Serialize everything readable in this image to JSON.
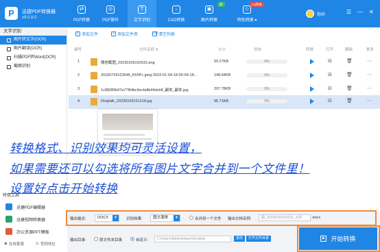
{
  "app": {
    "name": "迅捷PDF转换器",
    "version": "v9.0.8.0",
    "logo_letter": "P"
  },
  "nav": [
    {
      "label": "PDF转换",
      "icon": "convert-icon",
      "glyph": "⇄"
    },
    {
      "label": "PDF操作",
      "icon": "pdf-ops-icon",
      "glyph": "◎"
    },
    {
      "label": "文字识别",
      "icon": "ocr-icon",
      "glyph": "T"
    },
    {
      "label": "CAD转换",
      "icon": "cad-icon",
      "glyph": "↓"
    },
    {
      "label": "图片转换",
      "icon": "image-convert-icon",
      "glyph": "▣"
    },
    {
      "label": "特色转换",
      "icon": "special-convert-icon",
      "glyph": "◇"
    }
  ],
  "nav_badges": {
    "new": "新",
    "caj": "caj转换"
  },
  "nav_dropdown": "▾",
  "user": {
    "greeting": "你好"
  },
  "window_controls": [
    "☰",
    "—",
    "✕"
  ],
  "sidebar": {
    "title": "文字识别",
    "items": [
      {
        "label": "图片转文字(OCR)",
        "icon": "image-text-icon"
      },
      {
        "label": "图片翻译(OCR)",
        "icon": "image-translate-icon"
      },
      {
        "label": "扫描PDF转Word(OCR)",
        "icon": "scan-pdf-icon"
      },
      {
        "label": "截图识别",
        "icon": "screenshot-icon"
      }
    ]
  },
  "toolbar": {
    "add_file": "添加文件",
    "add_folder": "添加文件夹",
    "clear": "清空列表",
    "add_glyph": "+",
    "clear_glyph": "⌫"
  },
  "table": {
    "headers": {
      "index": "编号",
      "name": "文件名称 ⇅",
      "size": "大小",
      "status": "状态",
      "convert": "转换",
      "open": "打开",
      "delete": "删除",
      "more": "更多"
    },
    "rows": [
      {
        "index": "1",
        "name": "微信截图_20230106162632.png",
        "size": "50.27KB",
        "progress": "0%"
      },
      {
        "index": "2",
        "name": "20160724123546_Kh5Pc.jpeg-2023-01-04-18-00-54-18...",
        "size": "148.64KB",
        "progress": "0%"
      },
      {
        "index": "3",
        "name": "1c88280b97a77f64bc9ecfa8b44dcb8_副本_副本.jpg",
        "size": "207.78KB",
        "progress": "0%"
      },
      {
        "index": "4",
        "name": "Dingtalk_20230109151218.jpg",
        "size": "96.71KB",
        "progress": "0%"
      }
    ],
    "action_glyphs": {
      "open": "⊟",
      "delete": "🗑",
      "more": "⋯"
    }
  },
  "overlay": [
    "转换格式、识别效果均可灵活设置，",
    "如果需要还可以勾选将所有图片文字合并到一个文件里！",
    "设置好点击开始转换"
  ],
  "tools": {
    "title": "特色工具",
    "items": [
      {
        "label": "迅捷PDF编辑器",
        "color": "#1f86e5",
        "icon": "pdf-editor-icon"
      },
      {
        "label": "迅捷视频转换器",
        "color": "#2aa36b",
        "icon": "video-converter-icon"
      },
      {
        "label": "办公资源PPT模板",
        "color": "#e25b3a",
        "icon": "ppt-template-icon"
      }
    ]
  },
  "footer": {
    "online_service": "在线客服",
    "website": "官网地址"
  },
  "settings": {
    "format_label": "输出格式:",
    "format_value": "DOCX",
    "effect_label": "识别效果:",
    "effect_value": "图文混排",
    "merge_label": "合并到一个文件",
    "filename_label": "输出文档名称:",
    "filename_value": "图_20230106162632_合并",
    "filename_ext": ".docx",
    "dir_label": "输出目录:",
    "dir_option1": "原文件夹目录",
    "dir_option2": "自定义:",
    "dir_path": "C:\\Users\\Administrator\\Desktop",
    "change_btn": "更改",
    "open_folder_btn": "打开文件目录"
  },
  "start_button": {
    "label": "开始转换",
    "glyph": "▶"
  },
  "colors": {
    "primary": "#1f86e5",
    "highlight": "#f08a3c",
    "overlay_text": "#1a4fd8"
  }
}
